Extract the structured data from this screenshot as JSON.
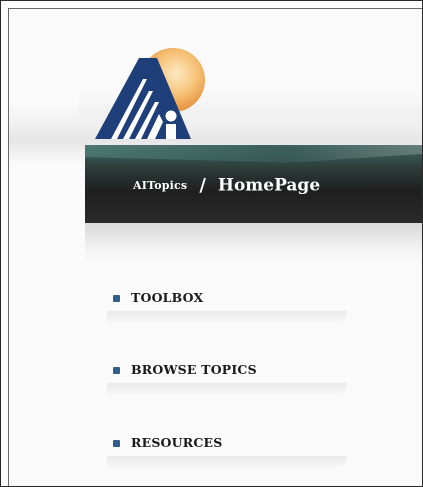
{
  "logo": {
    "name": "aitopics-logo-icon"
  },
  "breadcrumb": {
    "root": "AITopics",
    "separator": "/",
    "current": "HomePage"
  },
  "nav": {
    "items": [
      {
        "label": "TOOLBOX"
      },
      {
        "label": "BROWSE TOPICS"
      },
      {
        "label": "RESOURCES"
      }
    ]
  },
  "colors": {
    "logo_navy": "#1f3f7a",
    "logo_sun": "#f2a64a",
    "bullet": "#2f5f8a",
    "header_dark": "#1f1f1f"
  }
}
